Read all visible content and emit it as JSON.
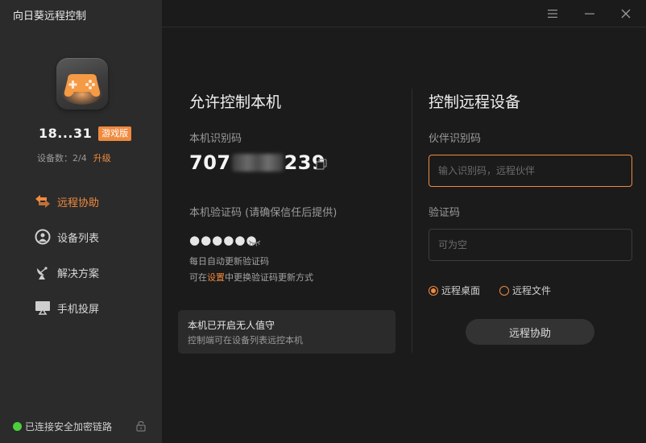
{
  "app": {
    "title": "向日葵远程控制"
  },
  "user": {
    "name": "18...31",
    "badge": "游戏版",
    "devices_label": "设备数：2/4",
    "upgrade_label": "升级"
  },
  "nav": {
    "items": [
      {
        "label": "远程协助",
        "icon": "remote-assist-icon",
        "active": true
      },
      {
        "label": "设备列表",
        "icon": "device-list-icon",
        "active": false
      },
      {
        "label": "解决方案",
        "icon": "satellite-icon",
        "active": false
      },
      {
        "label": "手机投屏",
        "icon": "screen-cast-icon",
        "active": false
      }
    ]
  },
  "status": {
    "text": "已连接安全加密链路"
  },
  "allow": {
    "title": "允许控制本机",
    "id_label": "本机识别码",
    "id_prefix": "707",
    "id_suffix": "239",
    "pass_label": "本机验证码 (请确保信任后提供)",
    "pass_value": "●●●●●●",
    "hint1": "每日自动更新验证码",
    "hint2_prefix": "可在",
    "hint2_link": "设置",
    "hint2_suffix": "中更换验证码更新方式",
    "unattended_title": "本机已开启无人值守",
    "unattended_sub": "控制端可在设备列表远控本机"
  },
  "control": {
    "title": "控制远程设备",
    "partner_label": "伙伴识别码",
    "partner_placeholder": "输入识别码，远程伙伴",
    "verify_label": "验证码",
    "verify_placeholder": "可为空",
    "option_desktop": "远程桌面",
    "option_file": "远程文件",
    "connect_label": "远程协助"
  },
  "colors": {
    "accent": "#f08a3e",
    "sidebar": "#2b2b2b",
    "background": "#1b1b1b",
    "status": "#4ccf3a"
  }
}
